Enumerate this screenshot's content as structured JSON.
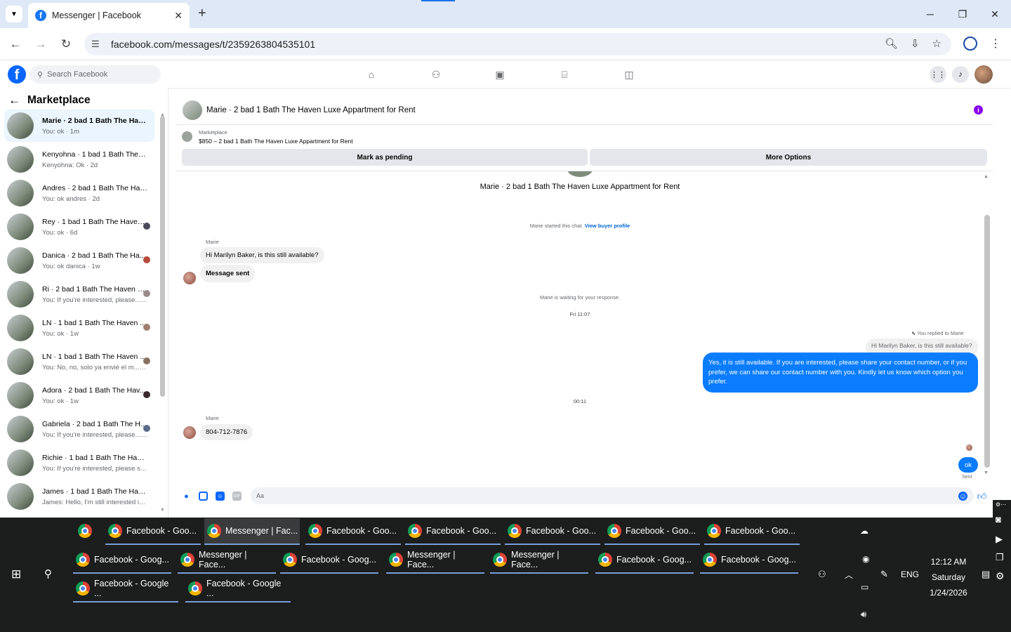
{
  "browser": {
    "tab_title": "Messenger | Facebook",
    "url": "facebook.com/messages/t/2359263804535101"
  },
  "facebook": {
    "search_placeholder": "Search Facebook"
  },
  "sidebar": {
    "title": "Marketplace",
    "conversations": [
      {
        "name": "Marie · 2 bad 1 Bath The Haven...",
        "snippet": "You: ok · 1m",
        "active": true
      },
      {
        "name": "Kenyohna · 1 bad 1 Bath The Ha...",
        "snippet": "Kenyohna: Ok · 2d"
      },
      {
        "name": "Andres · 2 bad 1 Bath The Have...",
        "snippet": "You: ok andres · 2d"
      },
      {
        "name": "Rey · 1 bad 1 Bath The Haven...",
        "snippet": "You: ok · 6d"
      },
      {
        "name": "Danica · 2 bad 1 Bath The Ha...",
        "snippet": "You: ok danica · 1w"
      },
      {
        "name": "Ri · 2 bad 1 Bath The Haven L...",
        "snippet": "You: If you're interested, please... · 1w"
      },
      {
        "name": "LN · 1 bad 1 Bath The Haven ...",
        "snippet": "You: ok · 1w"
      },
      {
        "name": "LN · 1 bad 1 Bath The Haven ...",
        "snippet": "You: No, no, solo ya envié el m... · 1w"
      },
      {
        "name": "Adora · 2 bad 1 Bath The Hav...",
        "snippet": "You: ok · 1w"
      },
      {
        "name": "Gabriela · 2 bad 1 Bath The H...",
        "snippet": "You: If you're interested, please... · 1w"
      },
      {
        "name": "Richie · 1 bad 1 Bath The Haven...",
        "snippet": "You: If you're interested, please sh... · 1w"
      },
      {
        "name": "James · 1 bad 1 Bath The Haven...",
        "snippet": "James: Hello, I'm still interested if ... · 1w"
      }
    ]
  },
  "chat": {
    "header_title": "Marie · 2 bad 1 Bath The Haven Luxe Appartment for Rent",
    "marketplace_label": "Marketplace",
    "listing": "$850 – 2 bad 1 Bath The Haven Luxe Appartment for Rent",
    "mark_pending": "Mark as pending",
    "more_options": "More Options",
    "intro_title": "Marie · 2 bad 1 Bath The Haven Luxe Appartment for Rent",
    "started_text": "Marie started this chat.",
    "view_profile": "View buyer profile",
    "sender_1": "Marie",
    "msg_1": "Hi Marilyn Baker, is this still available?",
    "msg_2": "Message sent",
    "waiting": "Marie is waiting for your response.",
    "time_1": "Fri 11:07",
    "replied_to": "You replied to Marie",
    "quoted": "Hi Marilyn Baker, is this still available?",
    "my_reply": "Yes, it is still available. If you are interested, please share your contact number, or if you prefer, we can share our contact number with you. Kindly let us know which option you prefer.",
    "time_2": "00:11",
    "sender_2": "Marie",
    "msg_3": "804-712-7876",
    "my_ok": "ok",
    "sent_status": "Sent",
    "composer_placeholder": "Aa"
  },
  "taskbar": {
    "row1": [
      "Facebook - Goo...",
      "Messenger | Fac...",
      "Facebook - Goo...",
      "Facebook - Goo...",
      "Facebook - Goo...",
      "Facebook - Goo...",
      "Facebook - Goo..."
    ],
    "row2": [
      "Facebook - Goog...",
      "Messenger | Face...",
      "Facebook - Goog...",
      "Messenger | Face...",
      "Messenger | Face...",
      "Facebook - Goog...",
      "Facebook - Goog..."
    ],
    "row3": [
      "Facebook - Google ...",
      "Facebook - Google ..."
    ],
    "lang": "ENG",
    "time": "12:12 AM",
    "day": "Saturday",
    "date": "1/24/2026"
  },
  "colors": {
    "facebook_blue": "#0866ff",
    "message_blue": "#0a7cff",
    "info_purple": "#8a00f0"
  }
}
